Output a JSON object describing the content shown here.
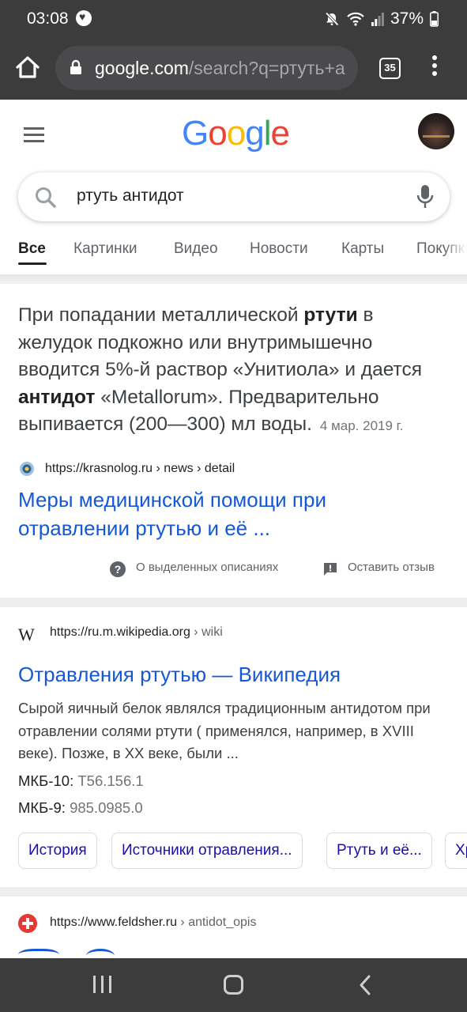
{
  "status_bar": {
    "time": "03:08",
    "battery": "37%"
  },
  "browser": {
    "url_host": "google.com",
    "url_path": "/search?q=ртуть+а",
    "tab_count": "35"
  },
  "google": {
    "logo_letters": [
      "G",
      "o",
      "o",
      "g",
      "l",
      "e"
    ],
    "logo_colors": [
      "#4285F4",
      "#EA4335",
      "#FBBC05",
      "#4285F4",
      "#34A853",
      "#EA4335"
    ],
    "search_query": "ртуть антидот",
    "tabs": [
      "Все",
      "Картинки",
      "Видео",
      "Новости",
      "Карты",
      "Покупки"
    ]
  },
  "snippet": {
    "t1": "При попадании металлической ",
    "b1": "ртути",
    "t2": " в желудок подкожно или внутримышечно вводится 5%-й раствор «Унитиола» и дается ",
    "b2": "антидот",
    "t3": " «Metallorum». Предварительно выпивается (200—300) мл воды.",
    "date": "4 мар. 2019 г.",
    "cite_url": "https://krasnolog.ru",
    "cite_path": " › news › detail",
    "title_line1": "Меры медицинской помощи при",
    "title_line2": "отравлении ртутью и её ...",
    "about_label": "О выделенных описаниях",
    "feedback_label": "Оставить отзыв"
  },
  "wiki_result": {
    "cite_url": "https://ru.m.wikipedia.org",
    "cite_path": " › wiki",
    "title": "Отравления ртутью — Википедия",
    "desc": "Сырой яичный белок являлся традиционным антидотом при отравлении солями ртути ( применялся, например, в XVIII веке). Позже, в XX веке, были ...",
    "icd10_label": "МКБ-10: ",
    "icd10_value": "T56.156.1",
    "icd9_label": "МКБ-9: ",
    "icd9_value": "985.0985.0",
    "chips": [
      "История",
      "Источники отравления...",
      "Ртуть и её...",
      "Хр"
    ]
  },
  "third_result": {
    "cite_url": "https://www.feldsher.ru",
    "cite_path": " › antidot_opis"
  }
}
